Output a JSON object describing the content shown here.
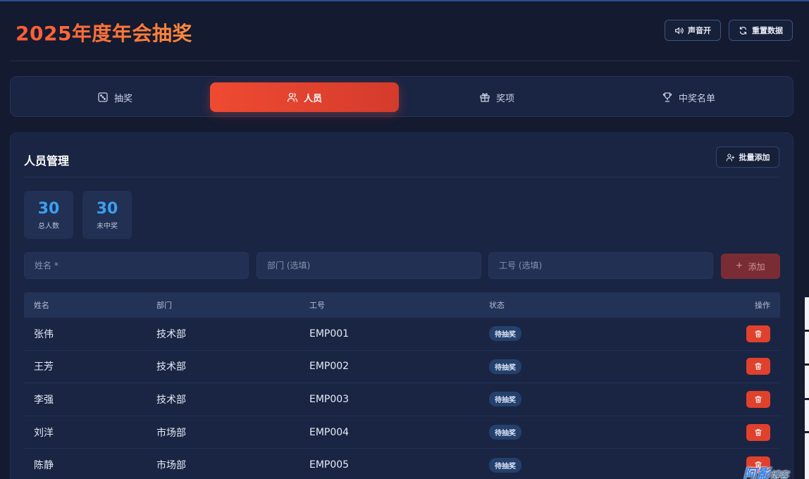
{
  "header": {
    "title": "2025年度年会抽奖",
    "sound_label": "声音开",
    "reset_label": "重置数据"
  },
  "tabs": [
    {
      "label": "抽奖",
      "icon": "dice-icon"
    },
    {
      "label": "人员",
      "icon": "users-icon",
      "active": true
    },
    {
      "label": "奖项",
      "icon": "gift-icon"
    },
    {
      "label": "中奖名单",
      "icon": "trophy-icon"
    }
  ],
  "panel": {
    "title": "人员管理",
    "bulk_add_label": "批量添加"
  },
  "stats": {
    "total": {
      "value": "30",
      "label": "总人数"
    },
    "remaining": {
      "value": "30",
      "label": "未中奖"
    }
  },
  "form": {
    "name_placeholder": "姓名 *",
    "dept_placeholder": "部门 (选填)",
    "id_placeholder": "工号 (选填)",
    "add_label": "添加"
  },
  "table": {
    "columns": [
      "姓名",
      "部门",
      "工号",
      "状态",
      "操作"
    ],
    "rows": [
      {
        "name": "张伟",
        "dept": "技术部",
        "id": "EMP001",
        "status": "待抽奖"
      },
      {
        "name": "王芳",
        "dept": "技术部",
        "id": "EMP002",
        "status": "待抽奖"
      },
      {
        "name": "李强",
        "dept": "技术部",
        "id": "EMP003",
        "status": "待抽奖"
      },
      {
        "name": "刘洋",
        "dept": "市场部",
        "id": "EMP004",
        "status": "待抽奖"
      },
      {
        "name": "陈静",
        "dept": "市场部",
        "id": "EMP005",
        "status": "待抽奖"
      }
    ]
  },
  "colors": {
    "accent": "#ef4a32",
    "stat_number": "#3aa0f0",
    "background": "#141a30"
  },
  "watermark": {
    "main": "阿影",
    "suffix": "博客"
  }
}
